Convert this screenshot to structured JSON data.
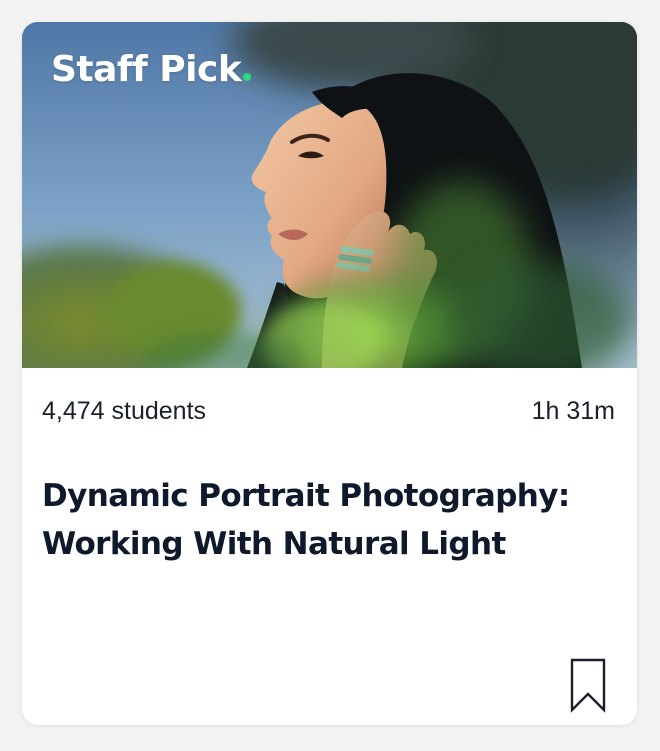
{
  "card": {
    "badge": {
      "text": "Staff Pick",
      "dot_color": "#2ed97a"
    },
    "thumbnail": {
      "icon": "portrait-photo"
    },
    "students": "4,474 students",
    "duration": "1h 31m",
    "title": "Dynamic Portrait Photography: Working With Natural Light",
    "save_icon": "bookmark-icon"
  },
  "colors": {
    "title": "#0e1a2b",
    "text": "#1a1f2b",
    "background": "#f2f2f2",
    "card": "#ffffff"
  }
}
